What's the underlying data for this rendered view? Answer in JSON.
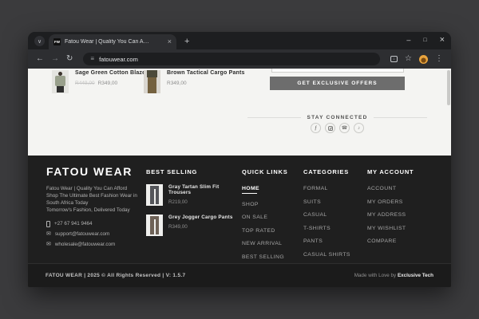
{
  "browser": {
    "tab_title": "Fatou Wear | Quality You Can A…",
    "favicon_text": "FW",
    "url": "fatouwear.com",
    "icons": {
      "tab_search": "∨",
      "tab_close": "×",
      "new_tab": "+",
      "minimize": "–",
      "maximize": "□",
      "close": "×",
      "back": "←",
      "forward": "→",
      "reload": "↻",
      "pill_site": "≡",
      "install_arrow": "↓",
      "star": "☆",
      "menu": "⋮"
    }
  },
  "content": {
    "products": [
      {
        "name": "Sage Green Cotton Blazer",
        "old_price": "R449,00",
        "price": "R349,00"
      },
      {
        "name": "Brown Tactical Cargo Pants",
        "price": "R349,00"
      }
    ],
    "newsletter_button": "GET EXCLUSIVE OFFERS",
    "stay_connected": "STAY CONNECTED",
    "social_icons": {
      "facebook": "f",
      "instagram": "instagram",
      "whatsapp": "☎",
      "tiktok": "♪"
    }
  },
  "footer": {
    "brand": "FATOU WEAR",
    "tagline": {
      "l1": "Fatou Wear | Quality You Can Afford",
      "l2": "Shop The Ultimate Best Fashion Wear in",
      "l3": "South Africa Today",
      "l4": "Tomorrow's Fashion, Delivered Today"
    },
    "contacts": {
      "phone": "+27 67 941 9464",
      "email1": "support@fatouwear.com",
      "email2": "wholesale@fatouwear.com",
      "mail_glyph": "✉"
    },
    "best_selling": {
      "title": "BEST SELLING",
      "items": [
        {
          "name": "Gray Tartan Slim Fit Trousers",
          "price": "R219,00"
        },
        {
          "name": "Grey Jogger Cargo Pants",
          "price": "R349,00"
        }
      ]
    },
    "quick_links": {
      "title": "QUICK LINKS",
      "items": [
        "HOME",
        "SHOP",
        "ON SALE",
        "TOP RATED",
        "NEW ARRIVAL",
        "BEST SELLING"
      ]
    },
    "categories": {
      "title": "CATEGORIES",
      "items": [
        "FORMAL",
        "SUITS",
        "CASUAL",
        "T-SHIRTS",
        "PANTS",
        "CASUAL SHIRTS"
      ]
    },
    "my_account": {
      "title": "MY ACCOUNT",
      "items": [
        "ACCOUNT",
        "MY ORDERS",
        "MY ADDRESS",
        "MY WISHLIST",
        "COMPARE"
      ]
    },
    "bottom": {
      "left": "FATOU WEAR | 2025 © All Rights Reserved | V: 1.5.7",
      "right_prefix": "Made with Love by ",
      "right_bold": "Exclusive Tech"
    }
  },
  "colors": {
    "offers_button": "#6d6d6d",
    "footer_bg": "#1f1f1f",
    "avatar_accent": "#e8a33d"
  }
}
